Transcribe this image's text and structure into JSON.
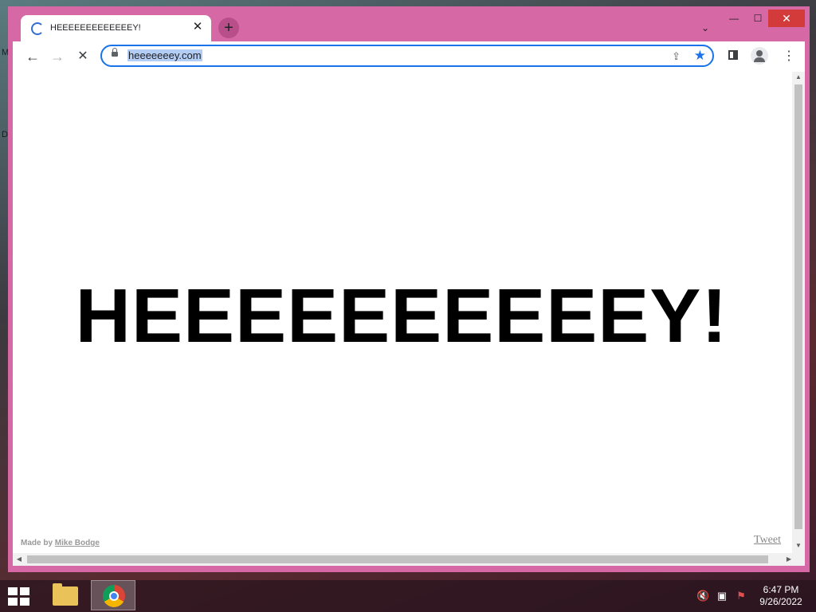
{
  "desktop": {
    "edge_glyph_top": "M",
    "edge_glyph_mid": "D"
  },
  "window": {
    "tab_title": "HEEEEEEEEEEEEEY!",
    "tab_close_glyph": "✕",
    "new_tab_glyph": "+",
    "tab_search_glyph": "⌄",
    "min_glyph": "—",
    "max_glyph": "☐",
    "close_glyph": "✕"
  },
  "toolbar": {
    "back_glyph": "←",
    "forward_glyph": "→",
    "stop_glyph": "✕",
    "url": "heeeeeeey.com",
    "share_glyph": "⇪",
    "star_glyph": "★",
    "menu_glyph": "⋮"
  },
  "page": {
    "headline": "HEEEEEEEEEEY!",
    "credit_prefix": "Made by",
    "credit_author": "Mike Bodge",
    "tweet_link": "Tweet"
  },
  "scrollbars": {
    "up": "▲",
    "down": "▼",
    "left": "◀",
    "right": "▶"
  },
  "taskbar": {
    "time": "6:47 PM",
    "date": "9/26/2022",
    "tray_volume": "🔇",
    "tray_network": "▣",
    "tray_flag": "⚑"
  },
  "colors": {
    "window_frame": "#d668a6",
    "accent": "#1a73e8",
    "close_button": "#d33a3a"
  }
}
